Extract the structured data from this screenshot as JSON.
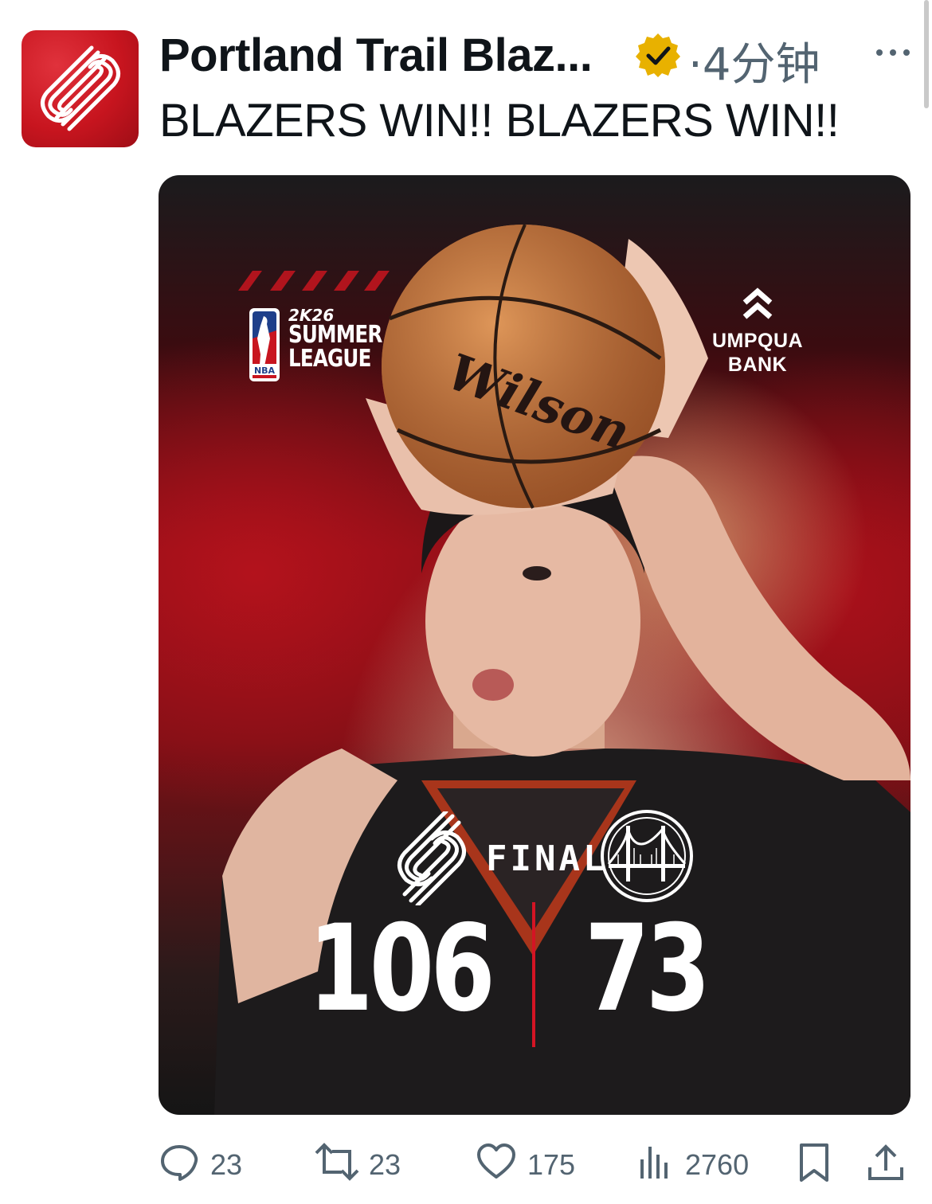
{
  "tweet": {
    "author_name": "Portland Trail Blaz...",
    "separator": "·",
    "time": "4分钟",
    "text": "BLAZERS WIN!! BLAZERS WIN!!"
  },
  "media": {
    "league_year": "2K26",
    "league_line1": "SUMMER",
    "league_line2": "LEAGUE",
    "nba_mark": "NBA",
    "sponsor_line1": "UMPQUA",
    "sponsor_line2": "BANK",
    "ball_brand": "Wilson",
    "status": "FINAL",
    "home_score": "106",
    "away_score": "73"
  },
  "actions": {
    "replies": "23",
    "reposts": "23",
    "likes": "175",
    "views": "2760"
  },
  "colors": {
    "brand_red": "#c8151f",
    "verified_gold": "#e8b100",
    "muted_text": "#536471",
    "divider_red": "#d41424"
  },
  "icons": [
    "blazers-logo-icon",
    "verified-badge-icon",
    "more-icon",
    "reply-icon",
    "repost-icon",
    "like-icon",
    "views-icon",
    "bookmark-icon",
    "share-icon",
    "warriors-logo-icon",
    "nba-logo-icon",
    "umpqua-logo-icon"
  ]
}
